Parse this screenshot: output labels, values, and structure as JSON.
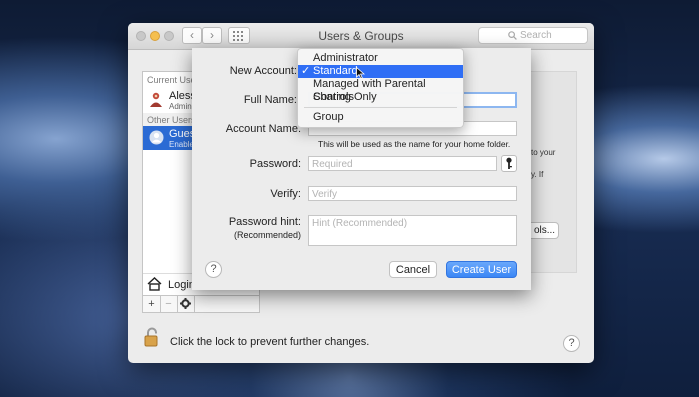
{
  "window": {
    "title": "Users & Groups",
    "search_placeholder": "Search",
    "nav_back": "‹",
    "nav_forward": "›",
    "grid_icon": "grid-icon"
  },
  "sidebar": {
    "current_users_label": "Current User",
    "current_user": {
      "name": "Aless",
      "role": "Admin"
    },
    "other_users_label": "Other Users",
    "guest_user": {
      "name": "Gues",
      "status": "Enable"
    },
    "login_label": "Login",
    "add_label": "+",
    "remove_label": "−",
    "gear_icon": "gear-icon"
  },
  "background_panel": {
    "text_lines": [
      "to your",
      "y. If"
    ],
    "button_label": "ols..."
  },
  "lock_text": "Click the lock to prevent further changes.",
  "help_label": "?",
  "sheet": {
    "new_account_label": "New Account:",
    "full_name_label": "Full Name:",
    "account_name_label": "Account Name:",
    "account_name_hint": "This will be used as the name for your home folder.",
    "password_label": "Password:",
    "password_placeholder": "Required",
    "verify_label": "Verify:",
    "verify_placeholder": "Verify",
    "hint_label": "Password hint:",
    "hint_sublabel": "(Recommended)",
    "hint_placeholder": "Hint (Recommended)",
    "help_label": "?",
    "cancel_label": "Cancel",
    "create_label": "Create User",
    "accent": "#3d8bf7"
  },
  "menu": {
    "items": [
      {
        "label": "Administrator",
        "selected": false
      },
      {
        "label": "Standard",
        "selected": true
      },
      {
        "label": "Managed with Parental Controls",
        "selected": false
      },
      {
        "label": "Sharing Only",
        "selected": false
      },
      {
        "label": "Group",
        "selected": false
      }
    ],
    "checkmark": "✓"
  }
}
